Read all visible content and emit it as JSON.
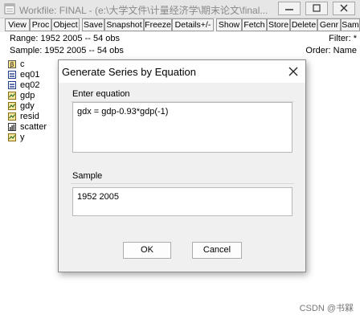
{
  "workfile": {
    "title": "Workfile: FINAL - (e:\\大学文件\\计量经济学\\期末论文\\final...",
    "toolbar": [
      "View",
      "Proc",
      "Object",
      "Save",
      "Snapshot",
      "Freeze",
      "Details+/-",
      "Show",
      "Fetch",
      "Store",
      "Delete",
      "Genr",
      "Sam"
    ],
    "range_label": "Range:  1952 2005   --   54 obs",
    "sample_label": "Sample: 1952 2005   --   54 obs",
    "filter_label": "Filter: *",
    "order_label": "Order: Name",
    "objects": [
      {
        "name": "c",
        "icon": "coef-icon"
      },
      {
        "name": "eq01",
        "icon": "equation-icon"
      },
      {
        "name": "eq02",
        "icon": "equation-icon"
      },
      {
        "name": "gdp",
        "icon": "series-icon"
      },
      {
        "name": "gdy",
        "icon": "series-icon"
      },
      {
        "name": "resid",
        "icon": "series-icon"
      },
      {
        "name": "scatter",
        "icon": "graph-icon"
      },
      {
        "name": "y",
        "icon": "series-icon"
      }
    ]
  },
  "dialog": {
    "title": "Generate Series by Equation",
    "equation_label": "Enter equation",
    "equation_value": "gdx = gdp-0.93*gdp(-1)",
    "sample_label": "Sample",
    "sample_value": "1952 2005",
    "ok_label": "OK",
    "cancel_label": "Cancel"
  },
  "watermark": "CSDN @书槑"
}
